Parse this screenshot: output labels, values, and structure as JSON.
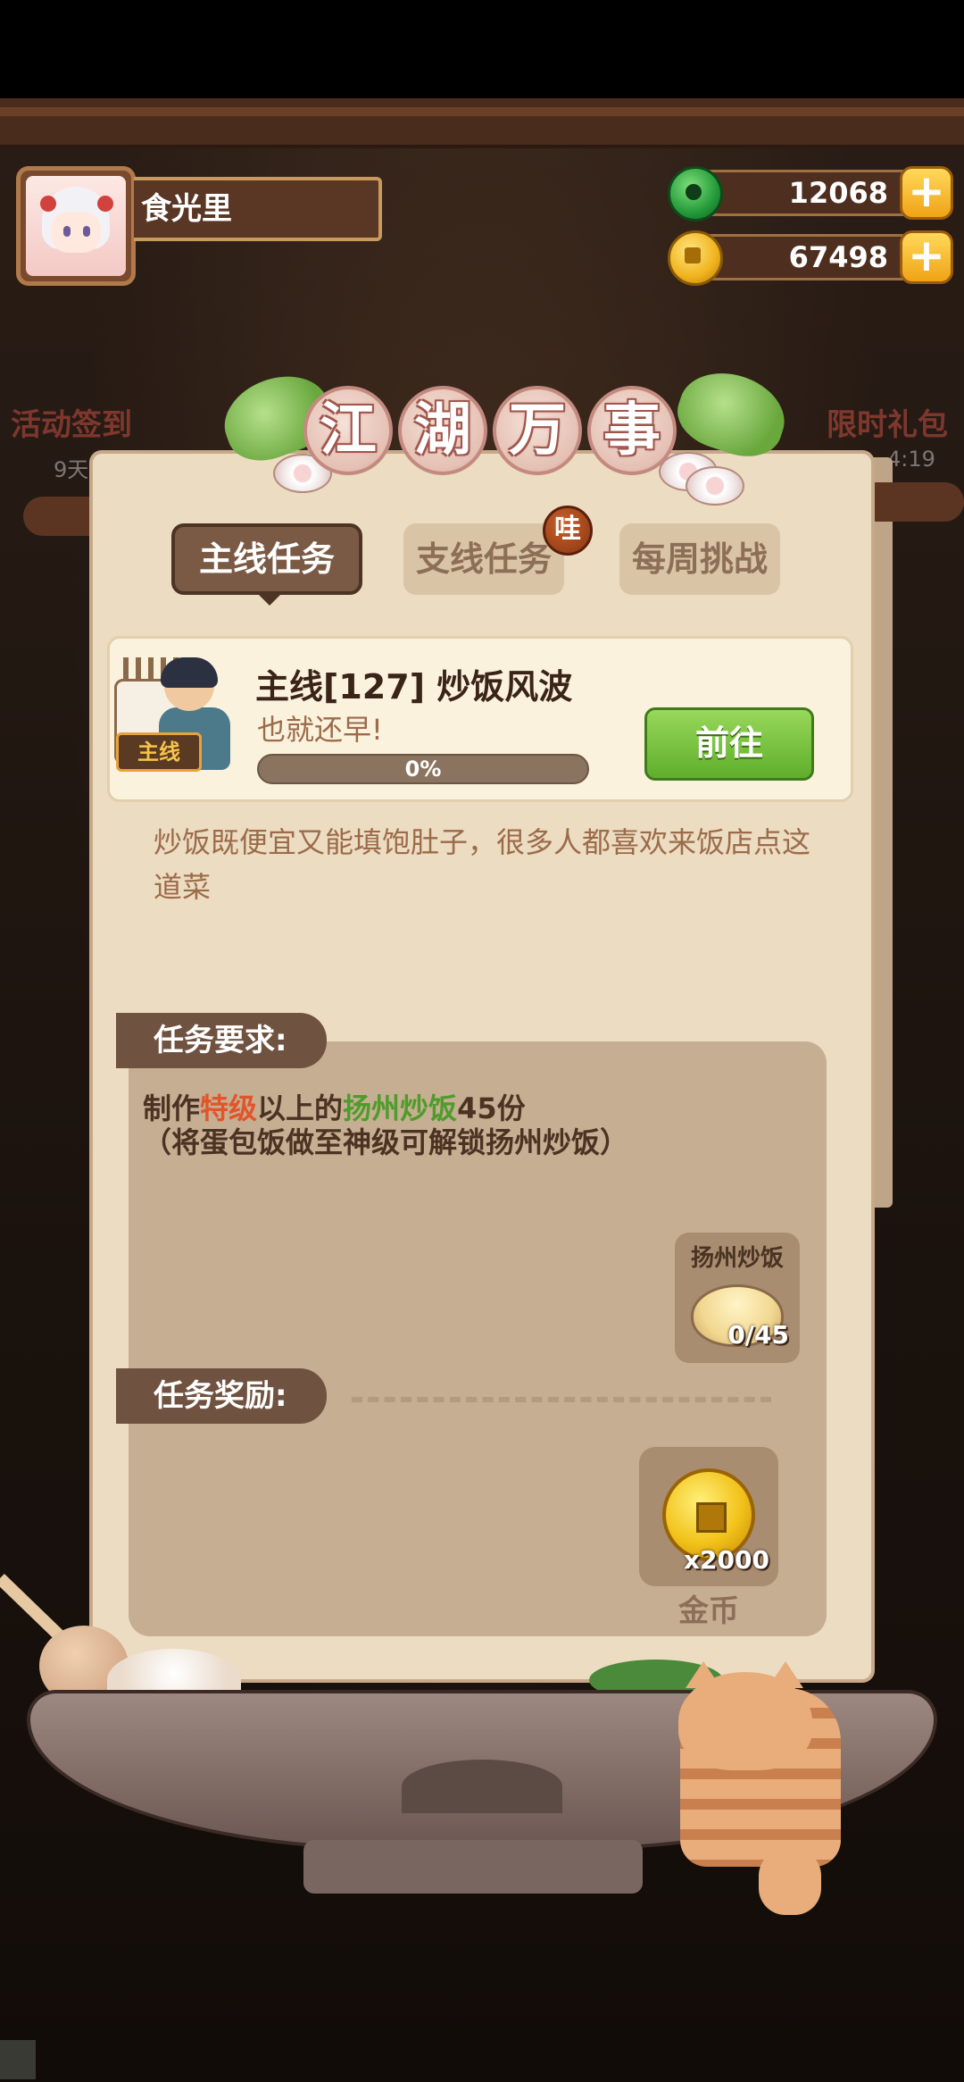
{
  "player": {
    "name": "食光里"
  },
  "currency": {
    "jade": "12068",
    "coins": "67498",
    "plus_symbol": "+"
  },
  "side_icons": {
    "left_label": "活动签到",
    "left_sub": "9天",
    "right_label": "限时礼包",
    "right_sub": "4:19"
  },
  "panel": {
    "title_chars": [
      "江",
      "湖",
      "万",
      "事"
    ],
    "tabs": [
      {
        "label": "主线任务",
        "selected": true
      },
      {
        "label": "支线任务",
        "selected": false
      },
      {
        "label": "每周挑战",
        "selected": false
      }
    ],
    "tab_badge": "哇"
  },
  "quest": {
    "tag": "主线",
    "title": "主线[127] 炒饭风波",
    "subtitle": "也就还早!",
    "progress": 0,
    "progress_label": "0%",
    "go_button": "前往",
    "description": "炒饭既便宜又能填饱肚子，很多人都喜欢来饭店点这道菜"
  },
  "requirements": {
    "heading": "任务要求:",
    "line1_prefix": "制作",
    "line1_grade": "特级",
    "line1_middle": "以上的",
    "line1_dish": "扬州炒饭",
    "line1_amount": "45份",
    "line2": "（将蛋包饭做至神级可解锁扬州炒饭）",
    "item": {
      "name": "扬州炒饭",
      "count": "0/45"
    }
  },
  "rewards": {
    "heading": "任务奖励:",
    "item": {
      "count": "x2000",
      "name": "金币"
    }
  },
  "colors": {
    "highlight_grade": "#e2552a",
    "highlight_dish": "#4e9c2a",
    "go_button": "#6fbe36"
  }
}
